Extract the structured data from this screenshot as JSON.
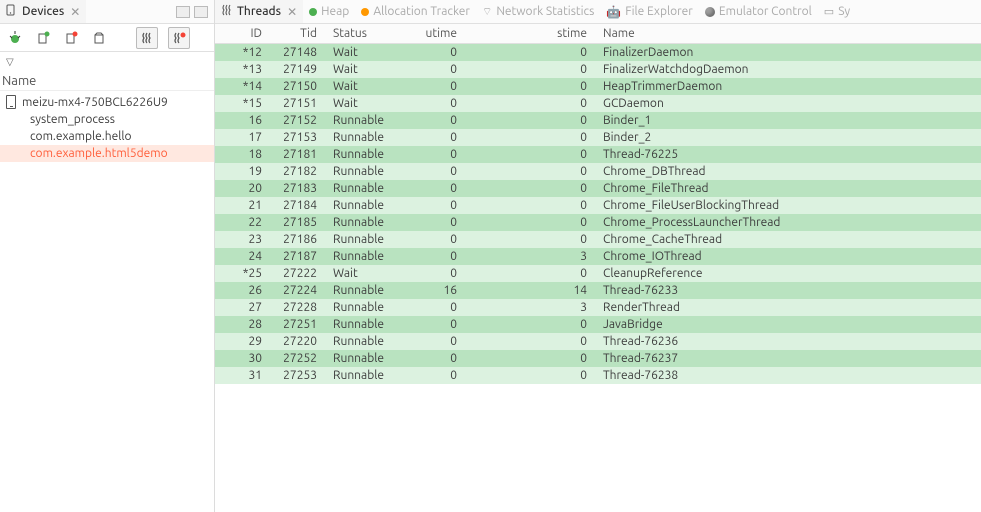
{
  "leftPane": {
    "tabTitle": "Devices",
    "header": "Name",
    "items": [
      {
        "label": "meizu-mx4-750BCL6226U9",
        "hasIcon": true,
        "selected": false
      },
      {
        "label": "system_process",
        "hasIcon": false,
        "selected": false
      },
      {
        "label": "com.example.hello",
        "hasIcon": false,
        "selected": false
      },
      {
        "label": "com.example.html5demo",
        "hasIcon": false,
        "selected": true
      }
    ]
  },
  "rightPane": {
    "tabs": [
      {
        "label": "Threads",
        "iconName": "threads-icon",
        "active": true,
        "closable": true
      },
      {
        "label": "Heap",
        "iconName": "heap-icon",
        "active": false
      },
      {
        "label": "Allocation Tracker",
        "iconName": "allocation-icon",
        "active": false
      },
      {
        "label": "Network Statistics",
        "iconName": "network-icon",
        "active": false
      },
      {
        "label": "File Explorer",
        "iconName": "file-explorer-icon",
        "active": false
      },
      {
        "label": "Emulator Control",
        "iconName": "emulator-icon",
        "active": false
      },
      {
        "label": "Sy",
        "iconName": "system-icon",
        "active": false
      }
    ],
    "columns": {
      "id": "ID",
      "tid": "Tid",
      "status": "Status",
      "utime": "utime",
      "stime": "stime",
      "name": "Name"
    },
    "rows": [
      {
        "id": "*12",
        "tid": "27148",
        "status": "Wait",
        "utime": "0",
        "stime": "0",
        "name": "FinalizerDaemon"
      },
      {
        "id": "*13",
        "tid": "27149",
        "status": "Wait",
        "utime": "0",
        "stime": "0",
        "name": "FinalizerWatchdogDaemon"
      },
      {
        "id": "*14",
        "tid": "27150",
        "status": "Wait",
        "utime": "0",
        "stime": "0",
        "name": "HeapTrimmerDaemon"
      },
      {
        "id": "*15",
        "tid": "27151",
        "status": "Wait",
        "utime": "0",
        "stime": "0",
        "name": "GCDaemon"
      },
      {
        "id": "16",
        "tid": "27152",
        "status": "Runnable",
        "utime": "0",
        "stime": "0",
        "name": "Binder_1"
      },
      {
        "id": "17",
        "tid": "27153",
        "status": "Runnable",
        "utime": "0",
        "stime": "0",
        "name": "Binder_2"
      },
      {
        "id": "18",
        "tid": "27181",
        "status": "Runnable",
        "utime": "0",
        "stime": "0",
        "name": "Thread-76225"
      },
      {
        "id": "19",
        "tid": "27182",
        "status": "Runnable",
        "utime": "0",
        "stime": "0",
        "name": "Chrome_DBThread"
      },
      {
        "id": "20",
        "tid": "27183",
        "status": "Runnable",
        "utime": "0",
        "stime": "0",
        "name": "Chrome_FileThread"
      },
      {
        "id": "21",
        "tid": "27184",
        "status": "Runnable",
        "utime": "0",
        "stime": "0",
        "name": "Chrome_FileUserBlockingThread"
      },
      {
        "id": "22",
        "tid": "27185",
        "status": "Runnable",
        "utime": "0",
        "stime": "0",
        "name": "Chrome_ProcessLauncherThread"
      },
      {
        "id": "23",
        "tid": "27186",
        "status": "Runnable",
        "utime": "0",
        "stime": "0",
        "name": "Chrome_CacheThread"
      },
      {
        "id": "24",
        "tid": "27187",
        "status": "Runnable",
        "utime": "0",
        "stime": "3",
        "name": "Chrome_IOThread"
      },
      {
        "id": "*25",
        "tid": "27222",
        "status": "Wait",
        "utime": "0",
        "stime": "0",
        "name": "CleanupReference"
      },
      {
        "id": "26",
        "tid": "27224",
        "status": "Runnable",
        "utime": "16",
        "stime": "14",
        "name": "Thread-76233"
      },
      {
        "id": "27",
        "tid": "27228",
        "status": "Runnable",
        "utime": "0",
        "stime": "3",
        "name": "RenderThread"
      },
      {
        "id": "28",
        "tid": "27251",
        "status": "Runnable",
        "utime": "0",
        "stime": "0",
        "name": "JavaBridge"
      },
      {
        "id": "29",
        "tid": "27220",
        "status": "Runnable",
        "utime": "0",
        "stime": "0",
        "name": "Thread-76236"
      },
      {
        "id": "30",
        "tid": "27252",
        "status": "Runnable",
        "utime": "0",
        "stime": "0",
        "name": "Thread-76237"
      },
      {
        "id": "31",
        "tid": "27253",
        "status": "Runnable",
        "utime": "0",
        "stime": "0",
        "name": "Thread-76238"
      }
    ]
  }
}
